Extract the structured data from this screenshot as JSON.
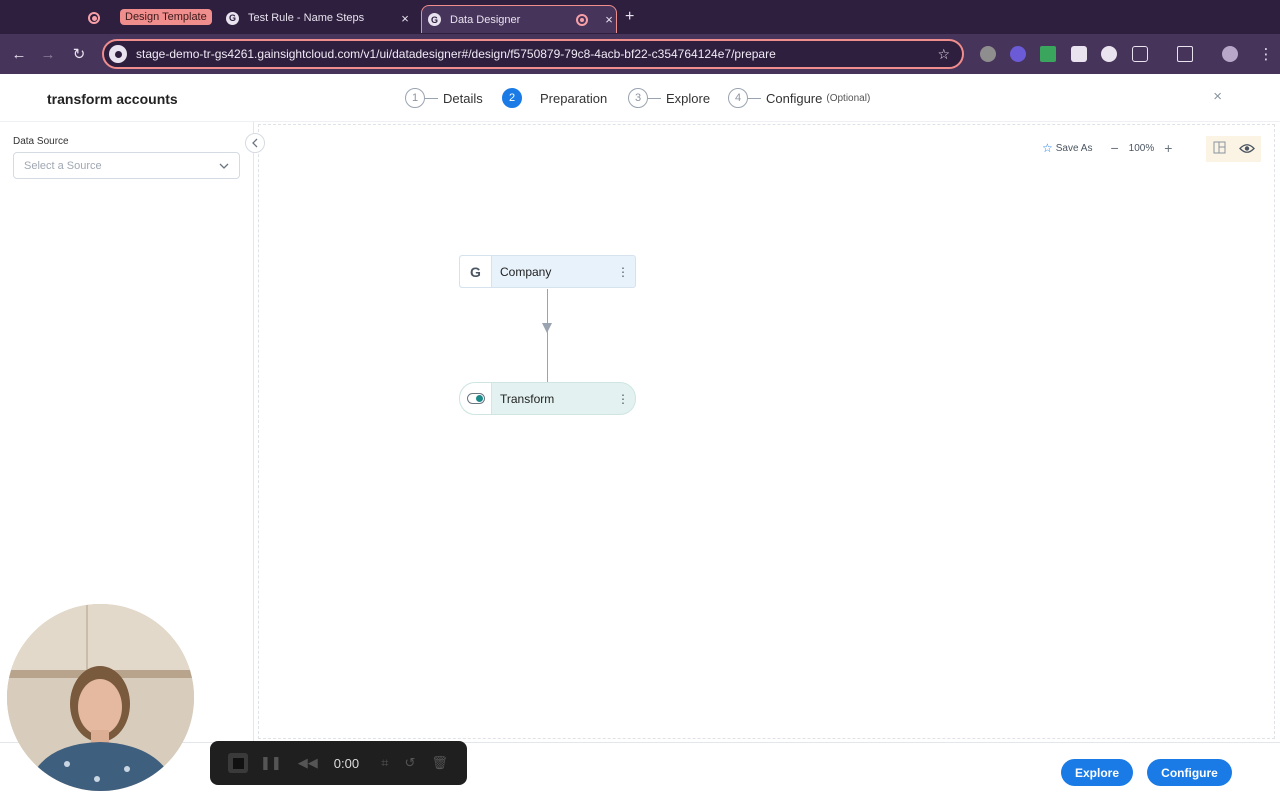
{
  "browser": {
    "tab_group_label": "Design Template",
    "tabs": [
      {
        "title": "Test Rule - Name Steps",
        "favicon": "G"
      },
      {
        "title": "Data Designer",
        "favicon": "G"
      }
    ],
    "close_glyph": "×",
    "new_tab_glyph": "+",
    "url": "stage-demo-tr-gs4261.gainsightcloud.com/v1/ui/datadesigner#/design/f5750879-79c8-4acb-bf22-c354764124e7/prepare",
    "accent_color": "#f08d8d"
  },
  "app": {
    "title": "transform accounts",
    "steps": [
      {
        "num": "1",
        "label": "Details",
        "optional": ""
      },
      {
        "num": "2",
        "label": "Preparation",
        "optional": ""
      },
      {
        "num": "3",
        "label": "Explore",
        "optional": ""
      },
      {
        "num": "4",
        "label": "Configure",
        "optional": "(Optional)"
      }
    ],
    "active_step": 2,
    "close_glyph": "×"
  },
  "sidebar": {
    "data_source_label": "Data Source",
    "select_placeholder": "Select a Source"
  },
  "canvas": {
    "save_as_label": "Save As",
    "zoom_level": "100%",
    "nodes": [
      {
        "label": "Company",
        "icon": "gainsight-icon"
      },
      {
        "label": "Transform",
        "icon": "transform-icon"
      }
    ]
  },
  "footer": {
    "explore_label": "Explore",
    "configure_label": "Configure",
    "button_color": "#1a7be6"
  },
  "recorder": {
    "time": "0:00"
  }
}
